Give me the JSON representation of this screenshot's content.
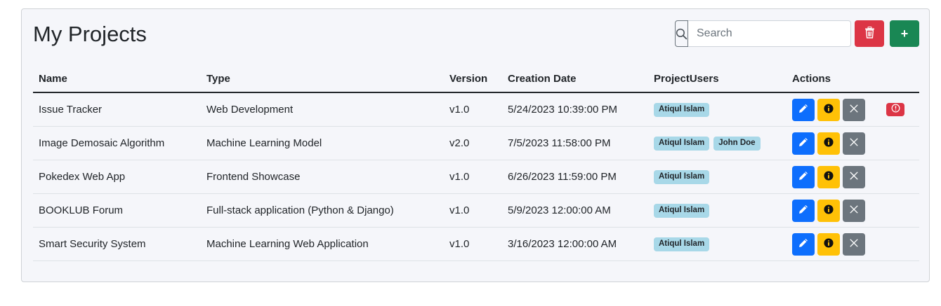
{
  "header": {
    "title": "My Projects",
    "search_placeholder": "Search",
    "add_label": "+"
  },
  "table": {
    "columns": [
      "Name",
      "Type",
      "Version",
      "Creation Date",
      "ProjectUsers",
      "Actions"
    ],
    "rows": [
      {
        "name": "Issue Tracker",
        "type": "Web Development",
        "version": "v1.0",
        "date": "5/24/2023 10:39:00 PM",
        "users": [
          "Atiqul Islam"
        ],
        "alert": true
      },
      {
        "name": "Image Demosaic Algorithm",
        "type": "Machine Learning Model",
        "version": "v2.0",
        "date": "7/5/2023 11:58:00 PM",
        "users": [
          "Atiqul Islam",
          "John Doe"
        ],
        "alert": false
      },
      {
        "name": "Pokedex Web App",
        "type": "Frontend Showcase",
        "version": "v1.0",
        "date": "6/26/2023 11:59:00 PM",
        "users": [
          "Atiqul Islam"
        ],
        "alert": false
      },
      {
        "name": "BOOKLUB Forum",
        "type": "Full-stack application (Python & Django)",
        "version": "v1.0",
        "date": "5/9/2023 12:00:00 AM",
        "users": [
          "Atiqul Islam"
        ],
        "alert": false
      },
      {
        "name": "Smart Security System",
        "type": "Machine Learning Web Application",
        "version": "v1.0",
        "date": "3/16/2023 12:00:00 AM",
        "users": [
          "Atiqul Islam"
        ],
        "alert": false
      }
    ]
  },
  "colors": {
    "card_bg": "#f5f6fa",
    "delete": "#dc3545",
    "add": "#198754",
    "edit": "#0d6efd",
    "info": "#ffc107",
    "remove": "#6c757d",
    "user_badge": "#a8d8e8"
  },
  "icons": {
    "search": "search-icon",
    "delete_all": "trash-icon",
    "edit": "pencil-icon",
    "info": "info-icon",
    "remove": "close-icon",
    "alert": "alert-circle-icon"
  }
}
